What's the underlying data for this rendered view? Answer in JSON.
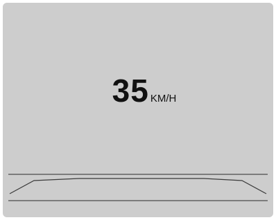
{
  "speedometer": {
    "value": "35",
    "unit": "KM/H"
  },
  "colors": {
    "background": "#cdcdcd",
    "text": "#111111",
    "road_lines": "#2b2b2b"
  }
}
